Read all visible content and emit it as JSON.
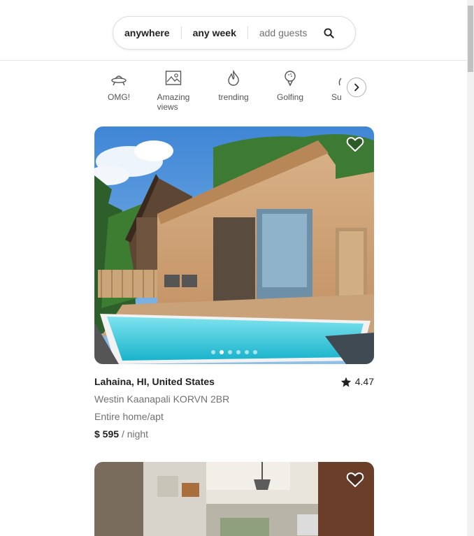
{
  "search": {
    "where": "anywhere",
    "when": "any week",
    "guests_placeholder": "add guests"
  },
  "categories": [
    {
      "label": "OMG!",
      "icon": "ufo-icon"
    },
    {
      "label": "Amazing views",
      "icon": "framed-picture-icon"
    },
    {
      "label": "trending",
      "icon": "flame-icon"
    },
    {
      "label": "Golfing",
      "icon": "golf-ball-icon"
    },
    {
      "label": "Su",
      "icon": "surfing-icon"
    }
  ],
  "listings": [
    {
      "location": "Lahaina, HI, United States",
      "rating": "4.47",
      "title": "Westin Kaanapali KORVN 2BR",
      "type": "Entire home/apt",
      "price": "$ 595",
      "price_unit": "/ night",
      "photo_count": 6,
      "active_photo": 2
    },
    {
      "location": "",
      "photo_count": 0
    }
  ],
  "colors": {
    "text": "#222222",
    "muted": "#717171",
    "border": "#dddddd"
  }
}
